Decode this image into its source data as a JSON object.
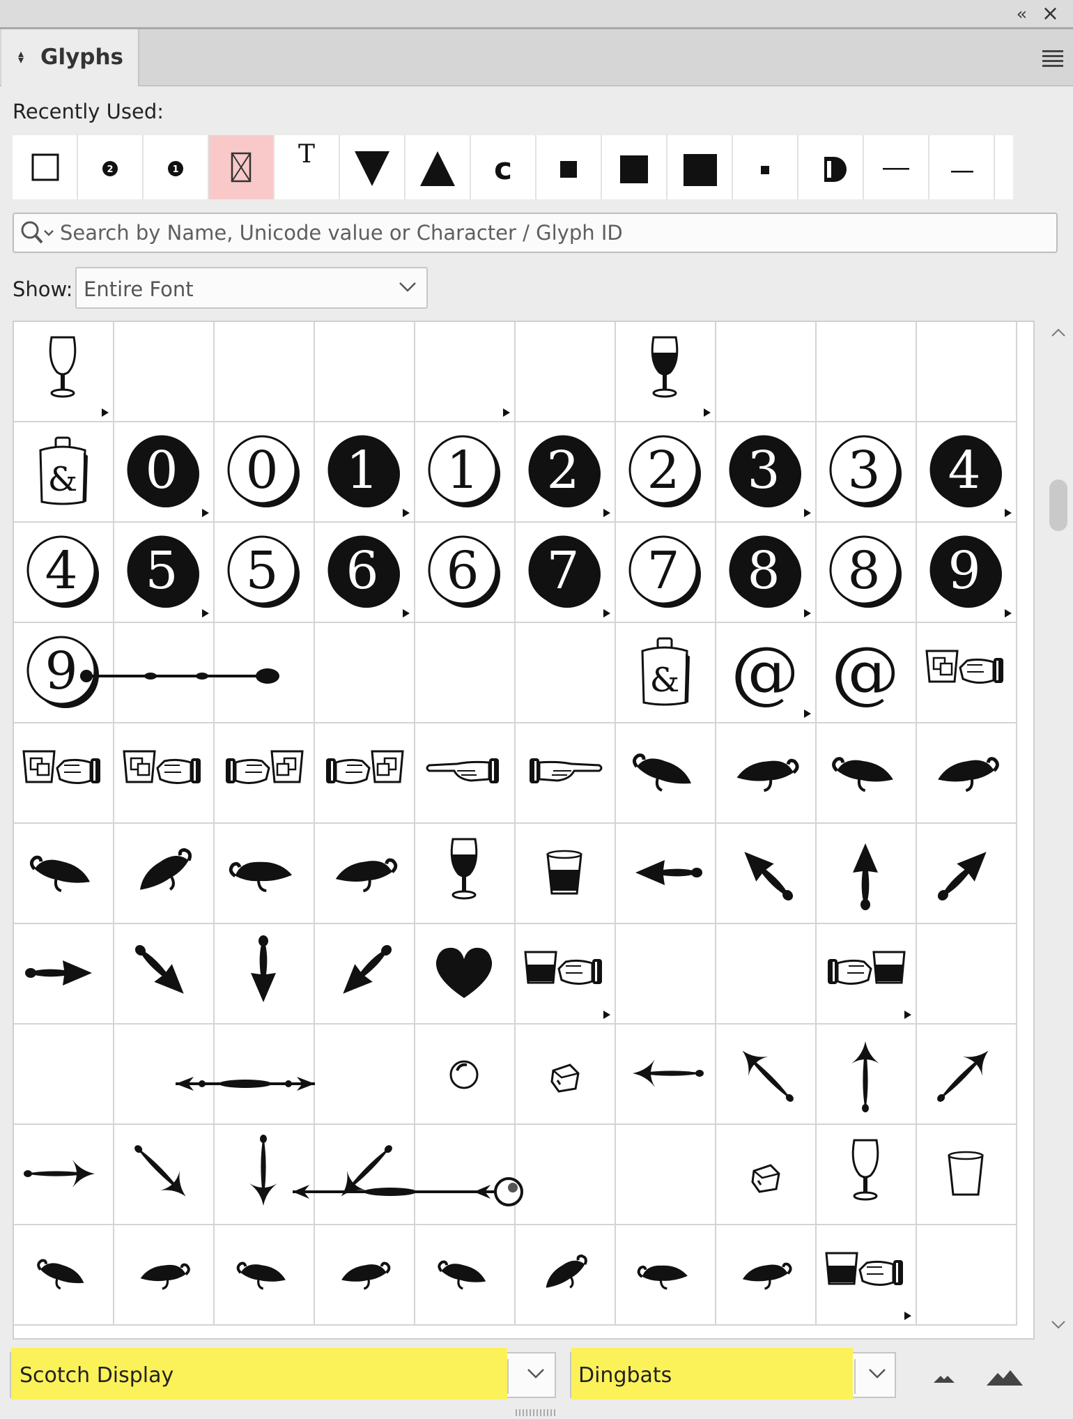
{
  "panel": {
    "title": "Glyphs",
    "recently_used_label": "Recently Used:",
    "recent_glyphs": [
      {
        "name": "square-outline"
      },
      {
        "name": "circled-2"
      },
      {
        "name": "circled-1"
      },
      {
        "name": "missing-glyph",
        "selected": true
      },
      {
        "name": "serif-T"
      },
      {
        "name": "triangle-down"
      },
      {
        "name": "triangle-up"
      },
      {
        "name": "letter-c"
      },
      {
        "name": "small-square"
      },
      {
        "name": "medium-square"
      },
      {
        "name": "large-square"
      },
      {
        "name": "tiny-square"
      },
      {
        "name": "half-circle"
      },
      {
        "name": "em-dash"
      },
      {
        "name": "en-dash"
      }
    ],
    "search": {
      "placeholder": "Search by Name, Unicode value or Character / Glyph ID"
    },
    "show_label": "Show:",
    "show_value": "Entire Font",
    "font_family": "Scotch Display",
    "font_style": "Dingbats",
    "highlight_color": "#fbf25a",
    "selection_color": "#f9c9c9"
  },
  "grid": {
    "cells": [
      {
        "g": "glass-empty",
        "alt": true
      },
      {
        "g": ""
      },
      {
        "g": ""
      },
      {
        "g": ""
      },
      {
        "g": "",
        "alt": true
      },
      {
        "g": ""
      },
      {
        "g": "glass-full",
        "alt": true
      },
      {
        "g": ""
      },
      {
        "g": ""
      },
      {
        "g": ""
      },
      {
        "g": "flask"
      },
      {
        "g": "num",
        "t": "0",
        "style": "black",
        "alt": true
      },
      {
        "g": "num",
        "t": "0",
        "style": "white"
      },
      {
        "g": "num",
        "t": "1",
        "style": "black",
        "alt": true
      },
      {
        "g": "num",
        "t": "1",
        "style": "white"
      },
      {
        "g": "num",
        "t": "2",
        "style": "black",
        "alt": true
      },
      {
        "g": "num",
        "t": "2",
        "style": "white"
      },
      {
        "g": "num",
        "t": "3",
        "style": "black",
        "alt": true
      },
      {
        "g": "num",
        "t": "3",
        "style": "white"
      },
      {
        "g": "num",
        "t": "4",
        "style": "black",
        "alt": true
      },
      {
        "g": "num",
        "t": "4",
        "style": "white"
      },
      {
        "g": "num",
        "t": "5",
        "style": "black",
        "alt": true
      },
      {
        "g": "num",
        "t": "5",
        "style": "white"
      },
      {
        "g": "num",
        "t": "6",
        "style": "black",
        "alt": true
      },
      {
        "g": "num",
        "t": "6",
        "style": "white"
      },
      {
        "g": "num",
        "t": "7",
        "style": "black",
        "alt": true
      },
      {
        "g": "num",
        "t": "7",
        "style": "white"
      },
      {
        "g": "num",
        "t": "8",
        "style": "black",
        "alt": true
      },
      {
        "g": "num",
        "t": "8",
        "style": "white"
      },
      {
        "g": "num",
        "t": "9",
        "style": "black",
        "alt": true
      },
      {
        "g": "num",
        "t": "9",
        "style": "white"
      },
      {
        "g": ""
      },
      {
        "g": ""
      },
      {
        "g": ""
      },
      {
        "g": ""
      },
      {
        "g": ""
      },
      {
        "g": "flask"
      },
      {
        "g": "at",
        "t": "@",
        "alt": true
      },
      {
        "g": "at",
        "t": "@"
      },
      {
        "g": "hand-glass-left"
      },
      {
        "g": "hand-glass-left"
      },
      {
        "g": "hand-glass-left"
      },
      {
        "g": "hand-glass-right"
      },
      {
        "g": "hand-glass-right"
      },
      {
        "g": "hand-point-left"
      },
      {
        "g": "hand-point-right"
      },
      {
        "g": "leaf",
        "v": 0
      },
      {
        "g": "leaf",
        "v": 1
      },
      {
        "g": "leaf",
        "v": 2
      },
      {
        "g": "leaf",
        "v": 3
      },
      {
        "g": "leaf",
        "v": 4
      },
      {
        "g": "leaf",
        "v": 5
      },
      {
        "g": "leaf",
        "v": 6
      },
      {
        "g": "leaf",
        "v": 7
      },
      {
        "g": "glass-full"
      },
      {
        "g": "tumbler-full"
      },
      {
        "g": "arrow",
        "deg": 180
      },
      {
        "g": "arrow",
        "deg": 225
      },
      {
        "g": "arrow",
        "deg": 270
      },
      {
        "g": "arrow",
        "deg": 315
      },
      {
        "g": "arrow",
        "deg": 0
      },
      {
        "g": "arrow",
        "deg": 45
      },
      {
        "g": "arrow",
        "deg": 90
      },
      {
        "g": "arrow",
        "deg": 135
      },
      {
        "g": "heart"
      },
      {
        "g": "hand-tumbler-left",
        "alt": true
      },
      {
        "g": ""
      },
      {
        "g": ""
      },
      {
        "g": "hand-tumbler-right",
        "alt": true
      },
      {
        "g": ""
      },
      {
        "g": ""
      },
      {
        "g": ""
      },
      {
        "g": ""
      },
      {
        "g": ""
      },
      {
        "g": "ball"
      },
      {
        "g": "ice-cube"
      },
      {
        "g": "thin-arrow",
        "deg": 180
      },
      {
        "g": "thin-arrow",
        "deg": 225
      },
      {
        "g": "thin-arrow",
        "deg": 270
      },
      {
        "g": "thin-arrow",
        "deg": 315
      },
      {
        "g": "thin-arrow",
        "deg": 0
      },
      {
        "g": "thin-arrow",
        "deg": 45
      },
      {
        "g": "thin-arrow",
        "deg": 90
      },
      {
        "g": "thin-arrow",
        "deg": 135
      },
      {
        "g": ""
      },
      {
        "g": ""
      },
      {
        "g": ""
      },
      {
        "g": "ice-cube"
      },
      {
        "g": "glass-empty"
      },
      {
        "g": "tumbler-empty"
      },
      {
        "g": "leaf",
        "v": 0,
        "s": 0.8
      },
      {
        "g": "leaf",
        "v": 1,
        "s": 0.8
      },
      {
        "g": "leaf",
        "v": 2,
        "s": 0.8
      },
      {
        "g": "leaf",
        "v": 3,
        "s": 0.8
      },
      {
        "g": "leaf",
        "v": 4,
        "s": 0.8
      },
      {
        "g": "leaf",
        "v": 5,
        "s": 0.8
      },
      {
        "g": "leaf",
        "v": 6,
        "s": 0.8
      },
      {
        "g": "leaf",
        "v": 7,
        "s": 0.8
      },
      {
        "g": "hand-tumbler-left",
        "alt": true
      },
      {
        "g": ""
      }
    ]
  }
}
